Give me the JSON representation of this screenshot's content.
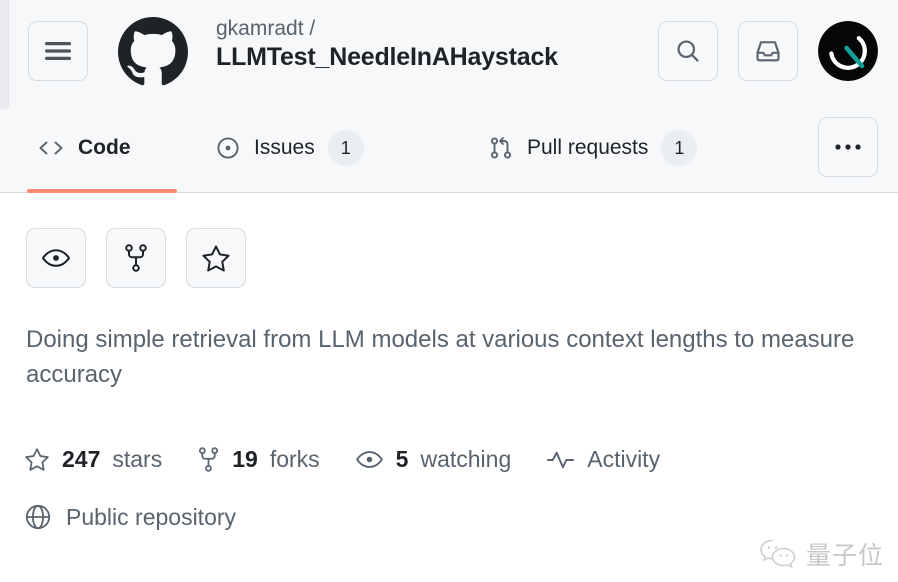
{
  "header": {
    "menu_button_icon": "hamburger-icon",
    "logo_icon": "github-logo-icon",
    "repo_owner": "gkamradt /",
    "repo_name": "LLMTest_NeedleInAHaystack",
    "search_icon": "search-icon",
    "inbox_icon": "inbox-icon",
    "avatar_icon": "user-avatar",
    "background_color": "#f6f8fa"
  },
  "tabs": {
    "active_underline_color": "#fd8c73",
    "overflow_label": "•••",
    "items": [
      {
        "label": "Code",
        "icon": "code-icon",
        "count": "",
        "active": true
      },
      {
        "label": "Issues",
        "icon": "issue-opened-icon",
        "count": "1",
        "active": false
      },
      {
        "label": "Pull requests",
        "icon": "git-pull-request-icon",
        "count": "1",
        "active": false
      }
    ]
  },
  "repo_actions": [
    {
      "name": "watch-button",
      "icon": "eye-icon"
    },
    {
      "name": "fork-button",
      "icon": "repo-forked-icon"
    },
    {
      "name": "star-button",
      "icon": "star-icon"
    }
  ],
  "repo": {
    "description": "Doing simple retrieval from LLM models at various context lengths to measure accuracy",
    "visibility": "Public repository",
    "visibility_icon": "globe-icon"
  },
  "stats": [
    {
      "icon": "star-icon",
      "value": "247",
      "label": "stars"
    },
    {
      "icon": "repo-forked-icon",
      "value": "19",
      "label": "forks"
    },
    {
      "icon": "eye-icon",
      "value": "5",
      "label": "watching"
    },
    {
      "icon": "pulse-icon",
      "value": "",
      "label": "Activity"
    }
  ],
  "watermark": {
    "icon": "wechat-icon",
    "text": "量子位"
  }
}
